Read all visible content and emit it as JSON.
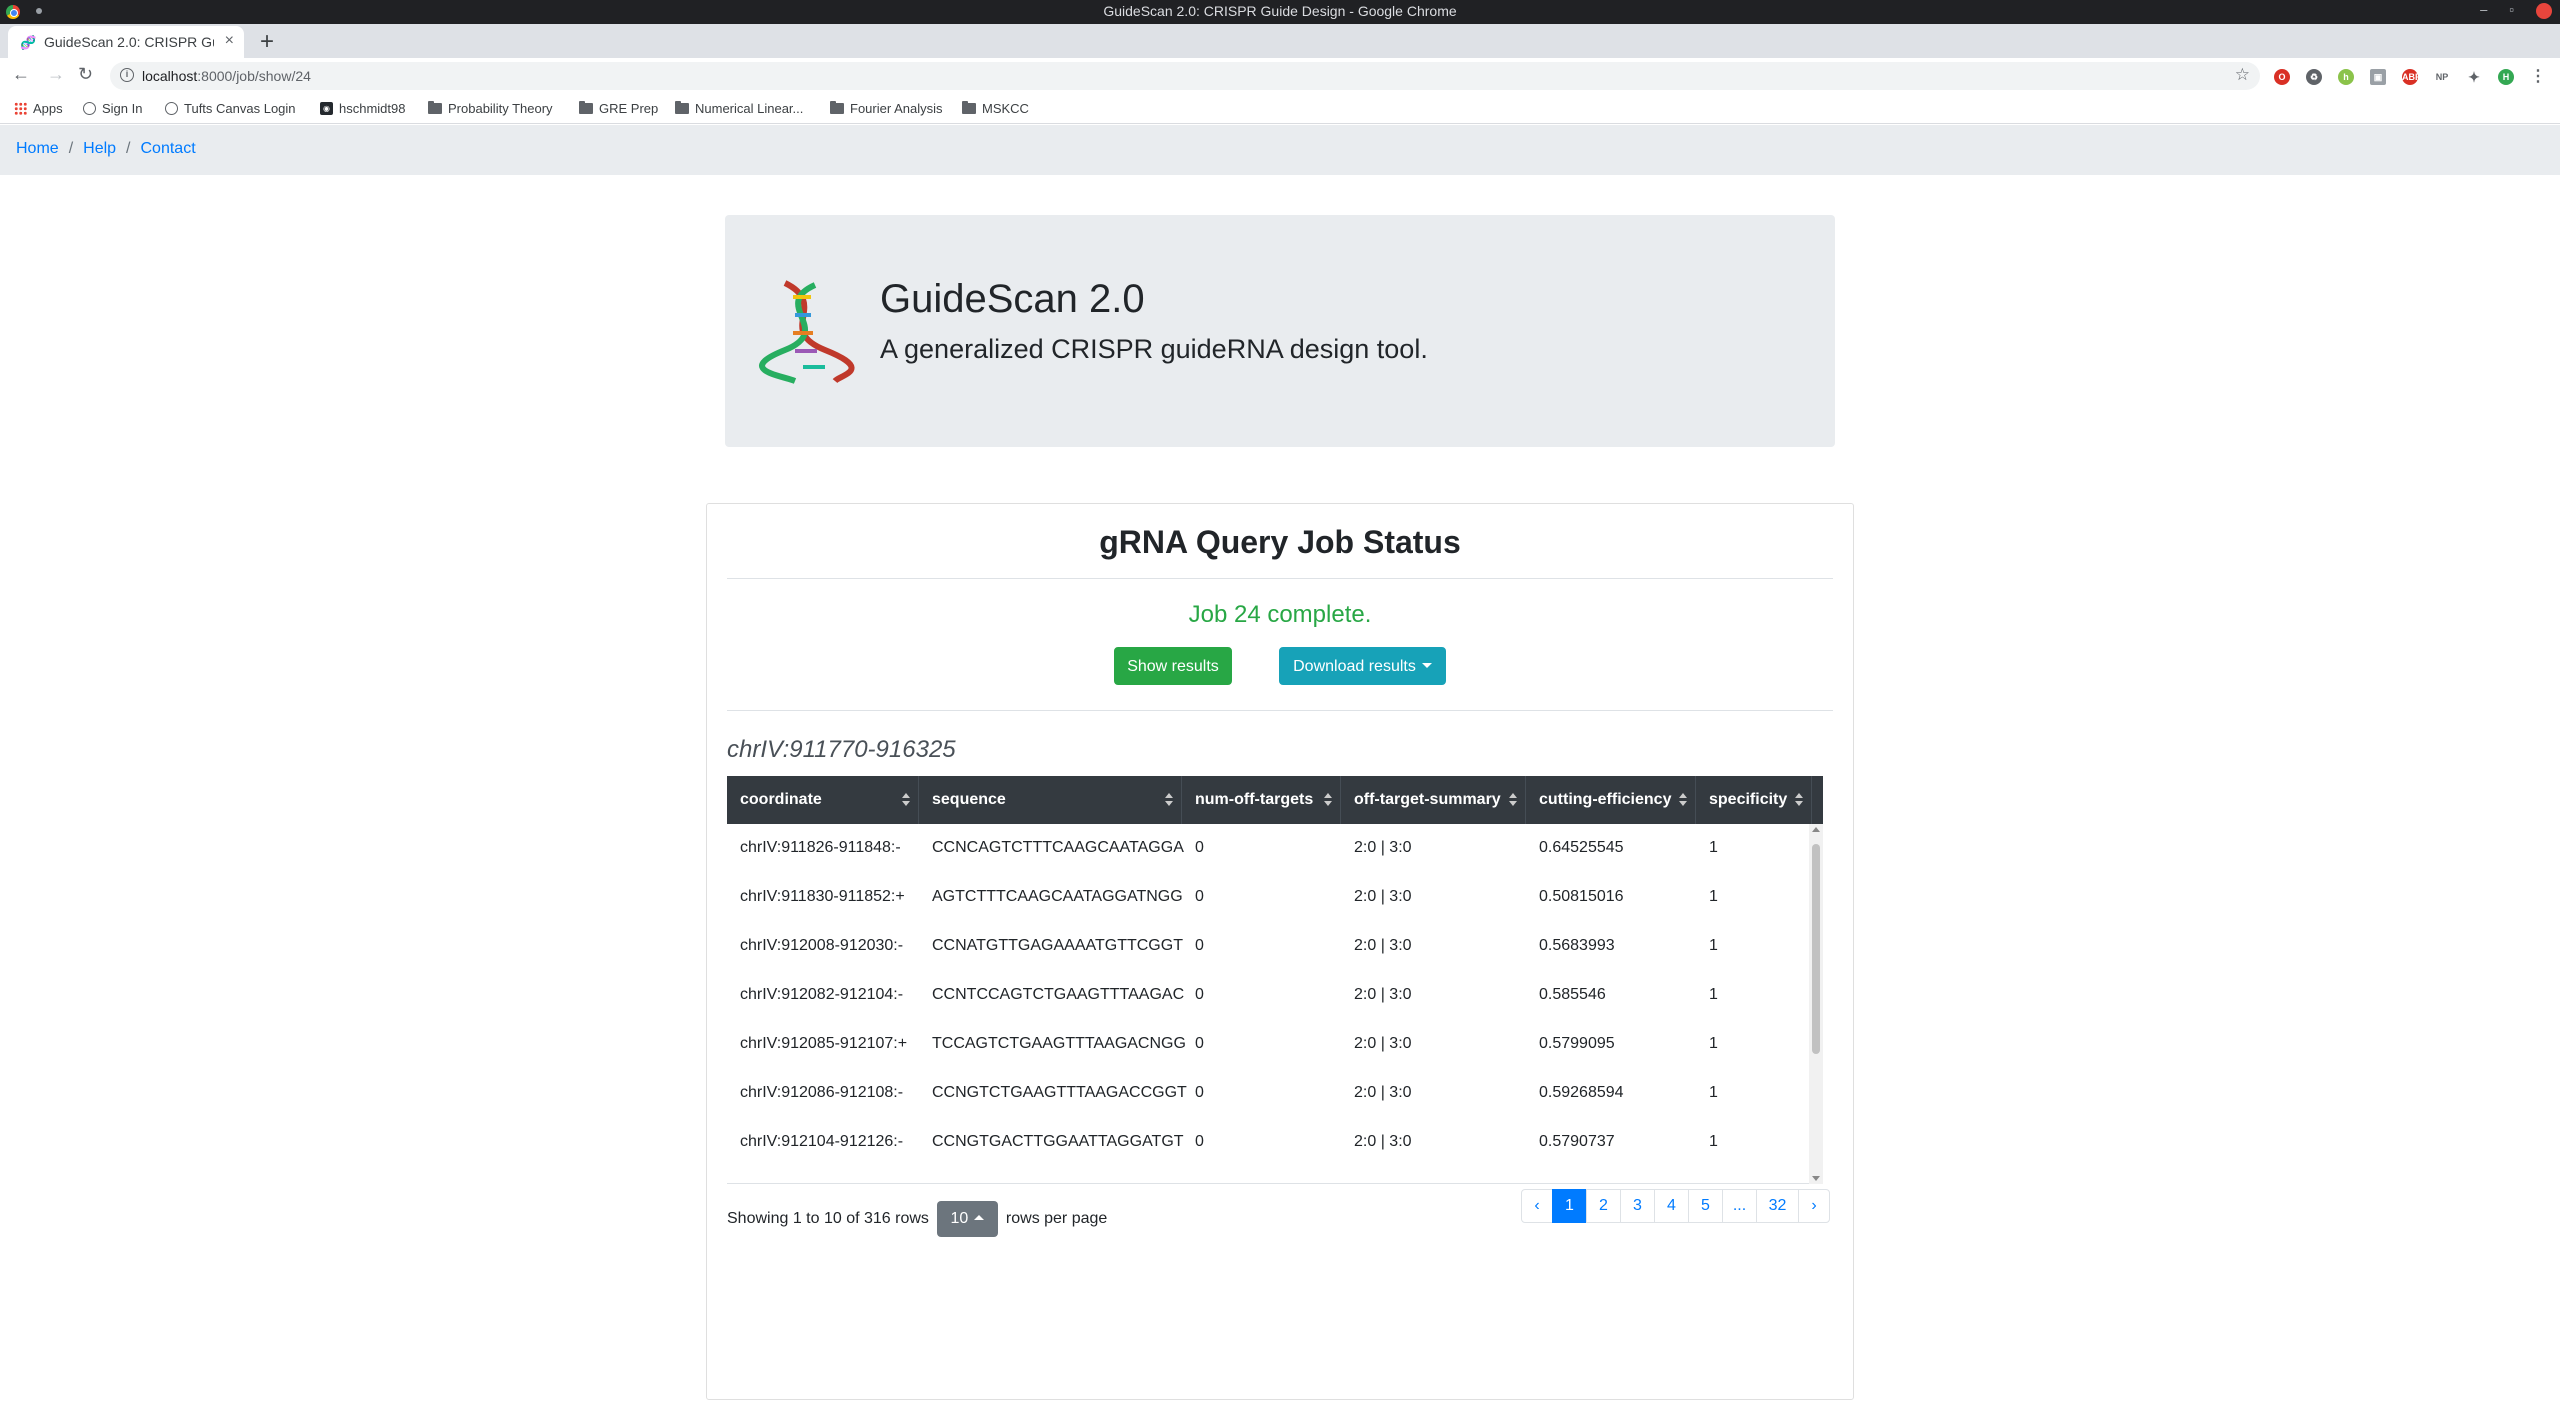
{
  "window": {
    "title": "GuideScan 2.0: CRISPR Guide Design - Google Chrome",
    "tab_title": "GuideScan 2.0: CRISPR Guide",
    "url_host": "localhost",
    "url_path": ":8000/job/show/24"
  },
  "bookmarks": {
    "items": [
      {
        "label": "Apps",
        "icon": "apps-icon"
      },
      {
        "label": "Sign In",
        "icon": "globe-icon"
      },
      {
        "label": "Tufts Canvas Login",
        "icon": "globe-icon"
      },
      {
        "label": "hschmidt98",
        "icon": "github-icon"
      },
      {
        "label": "Probability Theory",
        "icon": "folder-icon"
      },
      {
        "label": "GRE Prep",
        "icon": "folder-icon"
      },
      {
        "label": "Numerical Linear...",
        "icon": "folder-icon"
      },
      {
        "label": "Fourier Analysis",
        "icon": "folder-icon"
      },
      {
        "label": "MSKCC",
        "icon": "folder-icon"
      }
    ]
  },
  "breadcrumb": {
    "items": [
      "Home",
      "Help",
      "Contact"
    ],
    "separator": "/"
  },
  "hero": {
    "title": "GuideScan 2.0",
    "subtitle": "A generalized CRISPR guideRNA design tool.",
    "logo_icon": "dna-helix-icon"
  },
  "job": {
    "heading": "gRNA Query Job Status",
    "status": "Job 24 complete.",
    "show_results_label": "Show results",
    "download_results_label": "Download results",
    "region": "chrIV:911770-916325",
    "status_color": "#28a745"
  },
  "table": {
    "columns": [
      "coordinate",
      "sequence",
      "num-off-targets",
      "off-target-summary",
      "cutting-efficiency",
      "specificity"
    ],
    "rows": [
      [
        "chrIV:911826-911848:-",
        "CCNCAGTCTTTCAAGCAATAGGA",
        "0",
        "2:0 | 3:0",
        "0.64525545",
        "1"
      ],
      [
        "chrIV:911830-911852:+",
        "AGTCTTTCAAGCAATAGGATNGG",
        "0",
        "2:0 | 3:0",
        "0.50815016",
        "1"
      ],
      [
        "chrIV:912008-912030:-",
        "CCNATGTTGAGAAAATGTTCGGT",
        "0",
        "2:0 | 3:0",
        "0.5683993",
        "1"
      ],
      [
        "chrIV:912082-912104:-",
        "CCNTCCAGTCTGAAGTTTAAGAC",
        "0",
        "2:0 | 3:0",
        "0.585546",
        "1"
      ],
      [
        "chrIV:912085-912107:+",
        "TCCAGTCTGAAGTTTAAGACNGG",
        "0",
        "2:0 | 3:0",
        "0.5799095",
        "1"
      ],
      [
        "chrIV:912086-912108:-",
        "CCNGTCTGAAGTTTAAGACCGGT",
        "0",
        "2:0 | 3:0",
        "0.59268594",
        "1"
      ],
      [
        "chrIV:912104-912126:-",
        "CCNGTGACTTGGAATTAGGATGT",
        "0",
        "2:0 | 3:0",
        "0.5790737",
        "1"
      ]
    ]
  },
  "pager": {
    "showing": "Showing 1 to 10 of 316 rows",
    "page_size": "10",
    "rows_per_page": "rows per page",
    "pages": [
      "‹",
      "1",
      "2",
      "3",
      "4",
      "5",
      "...",
      "32",
      "›"
    ],
    "active_page": "1"
  }
}
